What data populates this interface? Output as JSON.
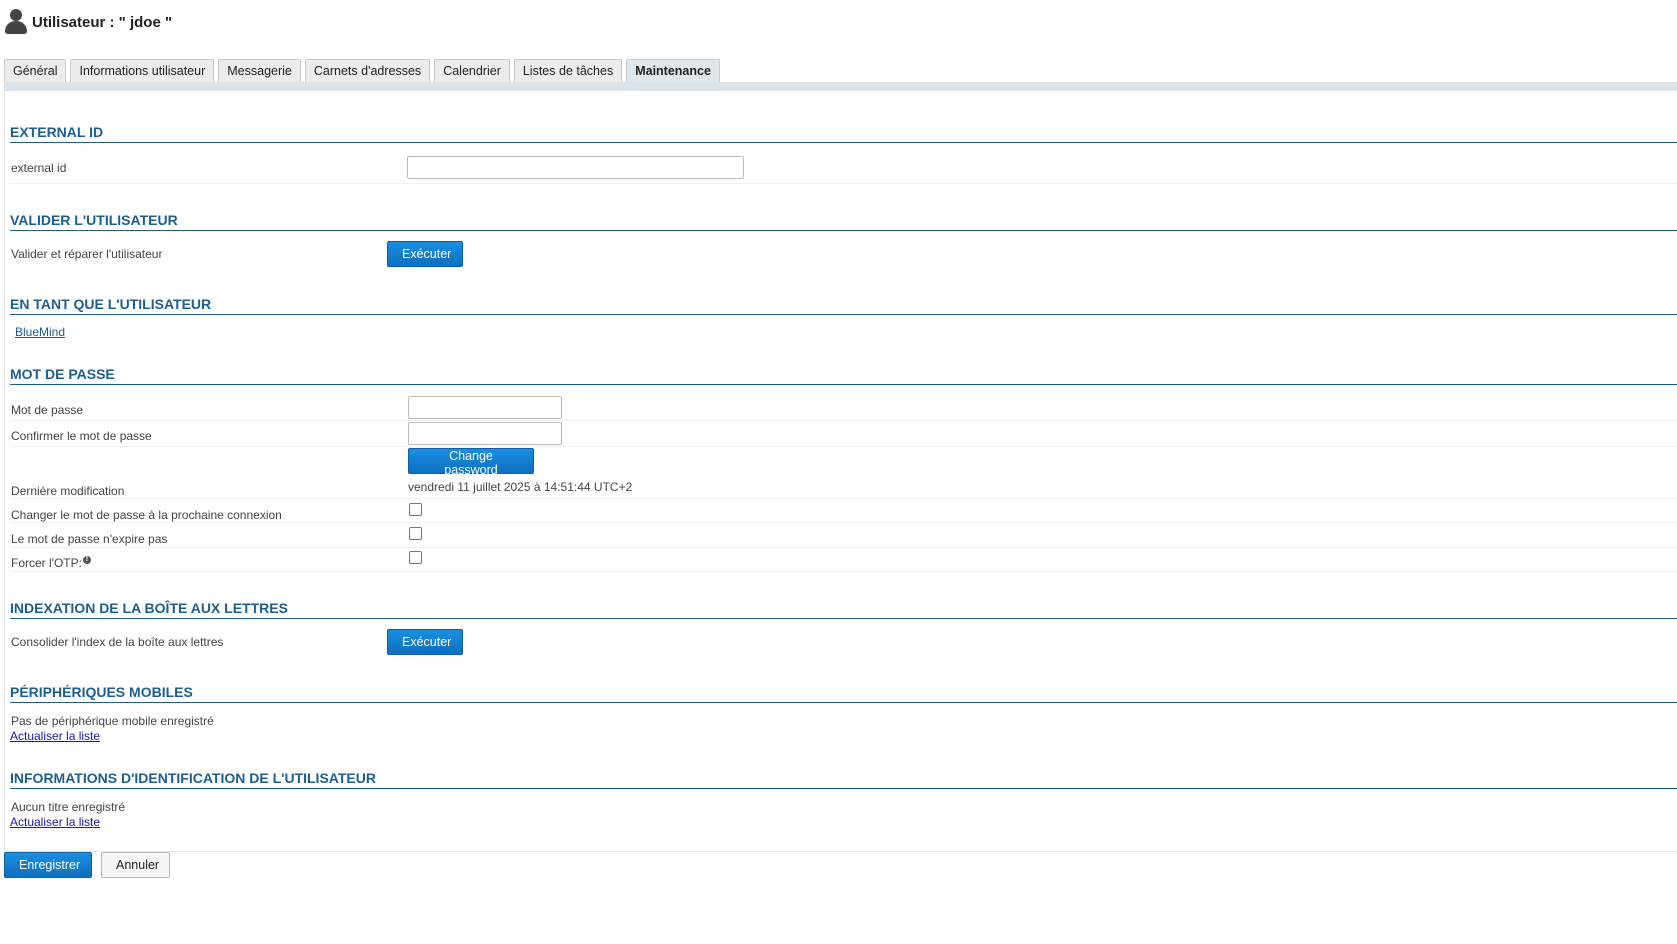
{
  "header": {
    "title": "Utilisateur : \" jdoe \"",
    "icon": "user-icon"
  },
  "tabs": [
    {
      "label": "Général"
    },
    {
      "label": "Informations utilisateur"
    },
    {
      "label": "Messagerie"
    },
    {
      "label": "Carnets d'adresses"
    },
    {
      "label": "Calendrier"
    },
    {
      "label": "Listes de tâches"
    },
    {
      "label": "Maintenance",
      "active": true
    }
  ],
  "external_id": {
    "title": "EXTERNAL ID",
    "label": "external id",
    "value": ""
  },
  "validate": {
    "title": "VALIDER L'UTILISATEUR",
    "label": "Valider et réparer l'utilisateur",
    "button": "Exécuter"
  },
  "as_user": {
    "title": "EN TANT QUE L'UTILISATEUR",
    "link": "BlueMind"
  },
  "password": {
    "title": "MOT DE PASSE",
    "password_label": "Mot de passe",
    "confirm_label": "Confirmer le mot de passe",
    "change_button": "Change password",
    "last_modified_label": "Dernière modification",
    "last_modified_value": "vendredi 11 juillet 2025 à 14:51:44 UTC+2",
    "change_next_label": "Changer le mot de passe à la prochaine connexion",
    "never_expire_label": "Le mot de passe n'expire pas",
    "force_otp_label": "Forcer l'OTP:",
    "change_next_checked": false,
    "never_expire_checked": false,
    "force_otp_checked": false
  },
  "indexing": {
    "title": "INDEXATION DE LA BOÎTE AUX LETTRES",
    "label": "Consolider l'index de la boîte aux lettres",
    "button": "Exécuter"
  },
  "mobile": {
    "title": "PÉRIPHÉRIQUES MOBILES",
    "empty_text": "Pas de périphérique mobile enregistré",
    "refresh_link": "Actualiser la liste"
  },
  "credentials": {
    "title": "INFORMATIONS D'IDENTIFICATION DE L'UTILISATEUR",
    "empty_text": "Aucun titre enregistré",
    "refresh_link": "Actualiser la liste"
  },
  "footer": {
    "save_button": "Enregistrer",
    "cancel_button": "Annuler"
  },
  "colors": {
    "accent": "#1e5e8e",
    "primary_button": "#1481d4",
    "link": "#1a1aa6"
  }
}
